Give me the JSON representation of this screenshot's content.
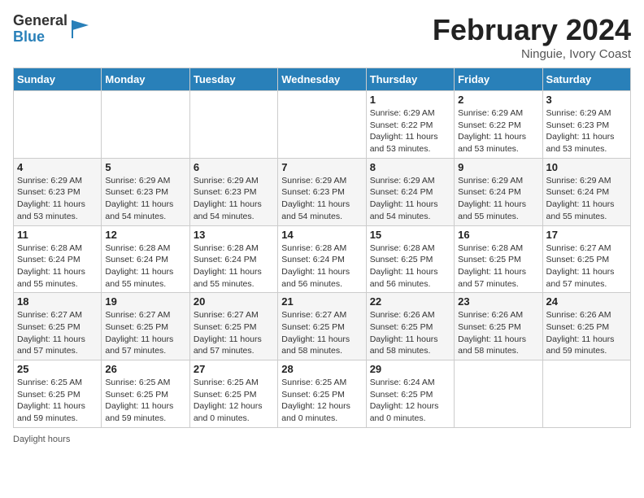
{
  "header": {
    "logo_general": "General",
    "logo_blue": "Blue",
    "month_year": "February 2024",
    "location": "Ninguie, Ivory Coast"
  },
  "days_of_week": [
    "Sunday",
    "Monday",
    "Tuesday",
    "Wednesday",
    "Thursday",
    "Friday",
    "Saturday"
  ],
  "weeks": [
    [
      {
        "day": "",
        "info": ""
      },
      {
        "day": "",
        "info": ""
      },
      {
        "day": "",
        "info": ""
      },
      {
        "day": "",
        "info": ""
      },
      {
        "day": "1",
        "info": "Sunrise: 6:29 AM\nSunset: 6:22 PM\nDaylight: 11 hours and 53 minutes."
      },
      {
        "day": "2",
        "info": "Sunrise: 6:29 AM\nSunset: 6:22 PM\nDaylight: 11 hours and 53 minutes."
      },
      {
        "day": "3",
        "info": "Sunrise: 6:29 AM\nSunset: 6:23 PM\nDaylight: 11 hours and 53 minutes."
      }
    ],
    [
      {
        "day": "4",
        "info": "Sunrise: 6:29 AM\nSunset: 6:23 PM\nDaylight: 11 hours and 53 minutes."
      },
      {
        "day": "5",
        "info": "Sunrise: 6:29 AM\nSunset: 6:23 PM\nDaylight: 11 hours and 54 minutes."
      },
      {
        "day": "6",
        "info": "Sunrise: 6:29 AM\nSunset: 6:23 PM\nDaylight: 11 hours and 54 minutes."
      },
      {
        "day": "7",
        "info": "Sunrise: 6:29 AM\nSunset: 6:23 PM\nDaylight: 11 hours and 54 minutes."
      },
      {
        "day": "8",
        "info": "Sunrise: 6:29 AM\nSunset: 6:24 PM\nDaylight: 11 hours and 54 minutes."
      },
      {
        "day": "9",
        "info": "Sunrise: 6:29 AM\nSunset: 6:24 PM\nDaylight: 11 hours and 55 minutes."
      },
      {
        "day": "10",
        "info": "Sunrise: 6:29 AM\nSunset: 6:24 PM\nDaylight: 11 hours and 55 minutes."
      }
    ],
    [
      {
        "day": "11",
        "info": "Sunrise: 6:28 AM\nSunset: 6:24 PM\nDaylight: 11 hours and 55 minutes."
      },
      {
        "day": "12",
        "info": "Sunrise: 6:28 AM\nSunset: 6:24 PM\nDaylight: 11 hours and 55 minutes."
      },
      {
        "day": "13",
        "info": "Sunrise: 6:28 AM\nSunset: 6:24 PM\nDaylight: 11 hours and 55 minutes."
      },
      {
        "day": "14",
        "info": "Sunrise: 6:28 AM\nSunset: 6:24 PM\nDaylight: 11 hours and 56 minutes."
      },
      {
        "day": "15",
        "info": "Sunrise: 6:28 AM\nSunset: 6:25 PM\nDaylight: 11 hours and 56 minutes."
      },
      {
        "day": "16",
        "info": "Sunrise: 6:28 AM\nSunset: 6:25 PM\nDaylight: 11 hours and 57 minutes."
      },
      {
        "day": "17",
        "info": "Sunrise: 6:27 AM\nSunset: 6:25 PM\nDaylight: 11 hours and 57 minutes."
      }
    ],
    [
      {
        "day": "18",
        "info": "Sunrise: 6:27 AM\nSunset: 6:25 PM\nDaylight: 11 hours and 57 minutes."
      },
      {
        "day": "19",
        "info": "Sunrise: 6:27 AM\nSunset: 6:25 PM\nDaylight: 11 hours and 57 minutes."
      },
      {
        "day": "20",
        "info": "Sunrise: 6:27 AM\nSunset: 6:25 PM\nDaylight: 11 hours and 57 minutes."
      },
      {
        "day": "21",
        "info": "Sunrise: 6:27 AM\nSunset: 6:25 PM\nDaylight: 11 hours and 58 minutes."
      },
      {
        "day": "22",
        "info": "Sunrise: 6:26 AM\nSunset: 6:25 PM\nDaylight: 11 hours and 58 minutes."
      },
      {
        "day": "23",
        "info": "Sunrise: 6:26 AM\nSunset: 6:25 PM\nDaylight: 11 hours and 58 minutes."
      },
      {
        "day": "24",
        "info": "Sunrise: 6:26 AM\nSunset: 6:25 PM\nDaylight: 11 hours and 59 minutes."
      }
    ],
    [
      {
        "day": "25",
        "info": "Sunrise: 6:25 AM\nSunset: 6:25 PM\nDaylight: 11 hours and 59 minutes."
      },
      {
        "day": "26",
        "info": "Sunrise: 6:25 AM\nSunset: 6:25 PM\nDaylight: 11 hours and 59 minutes."
      },
      {
        "day": "27",
        "info": "Sunrise: 6:25 AM\nSunset: 6:25 PM\nDaylight: 12 hours and 0 minutes."
      },
      {
        "day": "28",
        "info": "Sunrise: 6:25 AM\nSunset: 6:25 PM\nDaylight: 12 hours and 0 minutes."
      },
      {
        "day": "29",
        "info": "Sunrise: 6:24 AM\nSunset: 6:25 PM\nDaylight: 12 hours and 0 minutes."
      },
      {
        "day": "",
        "info": ""
      },
      {
        "day": "",
        "info": ""
      }
    ]
  ],
  "footer": {
    "note": "Daylight hours"
  }
}
